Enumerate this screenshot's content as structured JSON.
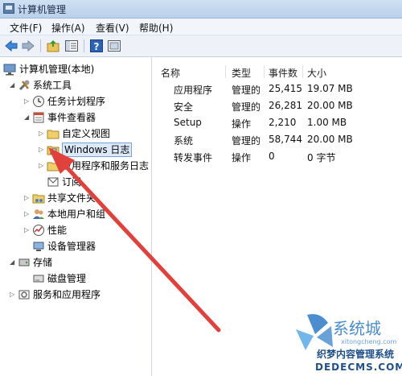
{
  "window": {
    "title": "计算机管理"
  },
  "menu": [
    "文件(F)",
    "操作(A)",
    "查看(V)",
    "帮助(H)"
  ],
  "toolbar": {
    "buttons": [
      "back-icon",
      "forward-icon",
      "folder-up-icon",
      "show-hide-tree-icon",
      "help-icon",
      "properties-icon"
    ]
  },
  "tree": {
    "root": "计算机管理(本地)",
    "system_tools": "系统工具",
    "task_scheduler": "任务计划程序",
    "event_viewer": "事件查看器",
    "custom_views": "自定义视图",
    "windows_logs": "Windows 日志",
    "app_service_logs": "应用程序和服务日志",
    "subscriptions": "订阅",
    "shared_folders": "共享文件夹",
    "local_users": "本地用户和组",
    "performance": "性能",
    "device_manager": "设备管理器",
    "storage": "存储",
    "disk_management": "磁盘管理",
    "services_apps": "服务和应用程序"
  },
  "list": {
    "columns": [
      "名称",
      "类型",
      "事件数",
      "大小"
    ],
    "rows": [
      {
        "name": "应用程序",
        "type": "管理的",
        "count": "25,415",
        "size": "19.07 MB"
      },
      {
        "name": "安全",
        "type": "管理的",
        "count": "26,281",
        "size": "20.00 MB"
      },
      {
        "name": "Setup",
        "type": "操作",
        "count": "2,210",
        "size": "1.00 MB"
      },
      {
        "name": "系统",
        "type": "管理的",
        "count": "58,744",
        "size": "20.00 MB"
      },
      {
        "name": "转发事件",
        "type": "操作",
        "count": "0",
        "size": "0 字节"
      }
    ]
  },
  "watermark": {
    "brand": "系统城",
    "domain_small": "xitongcheng.com",
    "line1": "织梦内容管理系统",
    "line2": "DEDECMS.COM"
  },
  "colors": {
    "arrow": "#e2403a",
    "selection": "#dbe9fb",
    "accent": "#2a79c9"
  }
}
